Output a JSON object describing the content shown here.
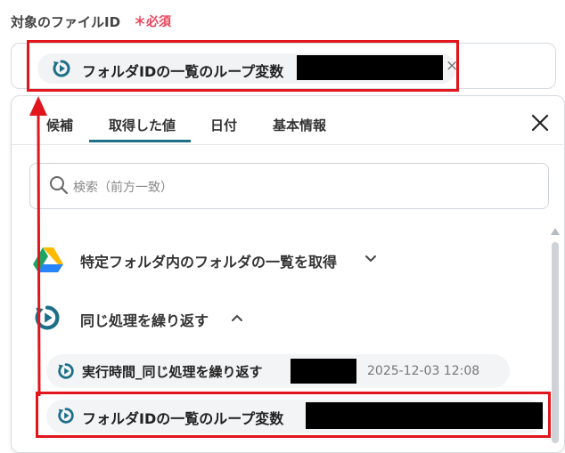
{
  "field": {
    "label": "対象のファイルID",
    "required": "＊必須",
    "selected_value": "フォルダIDの一覧のループ変数",
    "remove_glyph": "×"
  },
  "tabs": [
    {
      "label": "候補"
    },
    {
      "label": "取得した値"
    },
    {
      "label": "日付"
    },
    {
      "label": "基本情報"
    }
  ],
  "active_tab": "取得した値",
  "search": {
    "placeholder": "検索（前方一致）"
  },
  "groups": [
    {
      "title": "特定フォルダ内のフォルダの一覧を取得",
      "icon": "google-drive-icon",
      "expanded": false
    },
    {
      "title": "同じ処理を繰り返す",
      "icon": "loop-icon",
      "expanded": true
    }
  ],
  "items": [
    {
      "label": "実行時間_同じ処理を繰り返す",
      "timestamp": "2025-12-03 12:08"
    },
    {
      "label": "フォルダIDの一覧のループ変数"
    }
  ],
  "colors": {
    "accent": "#1d6f89",
    "required": "#e8455a",
    "annotation": "#e0161c"
  }
}
